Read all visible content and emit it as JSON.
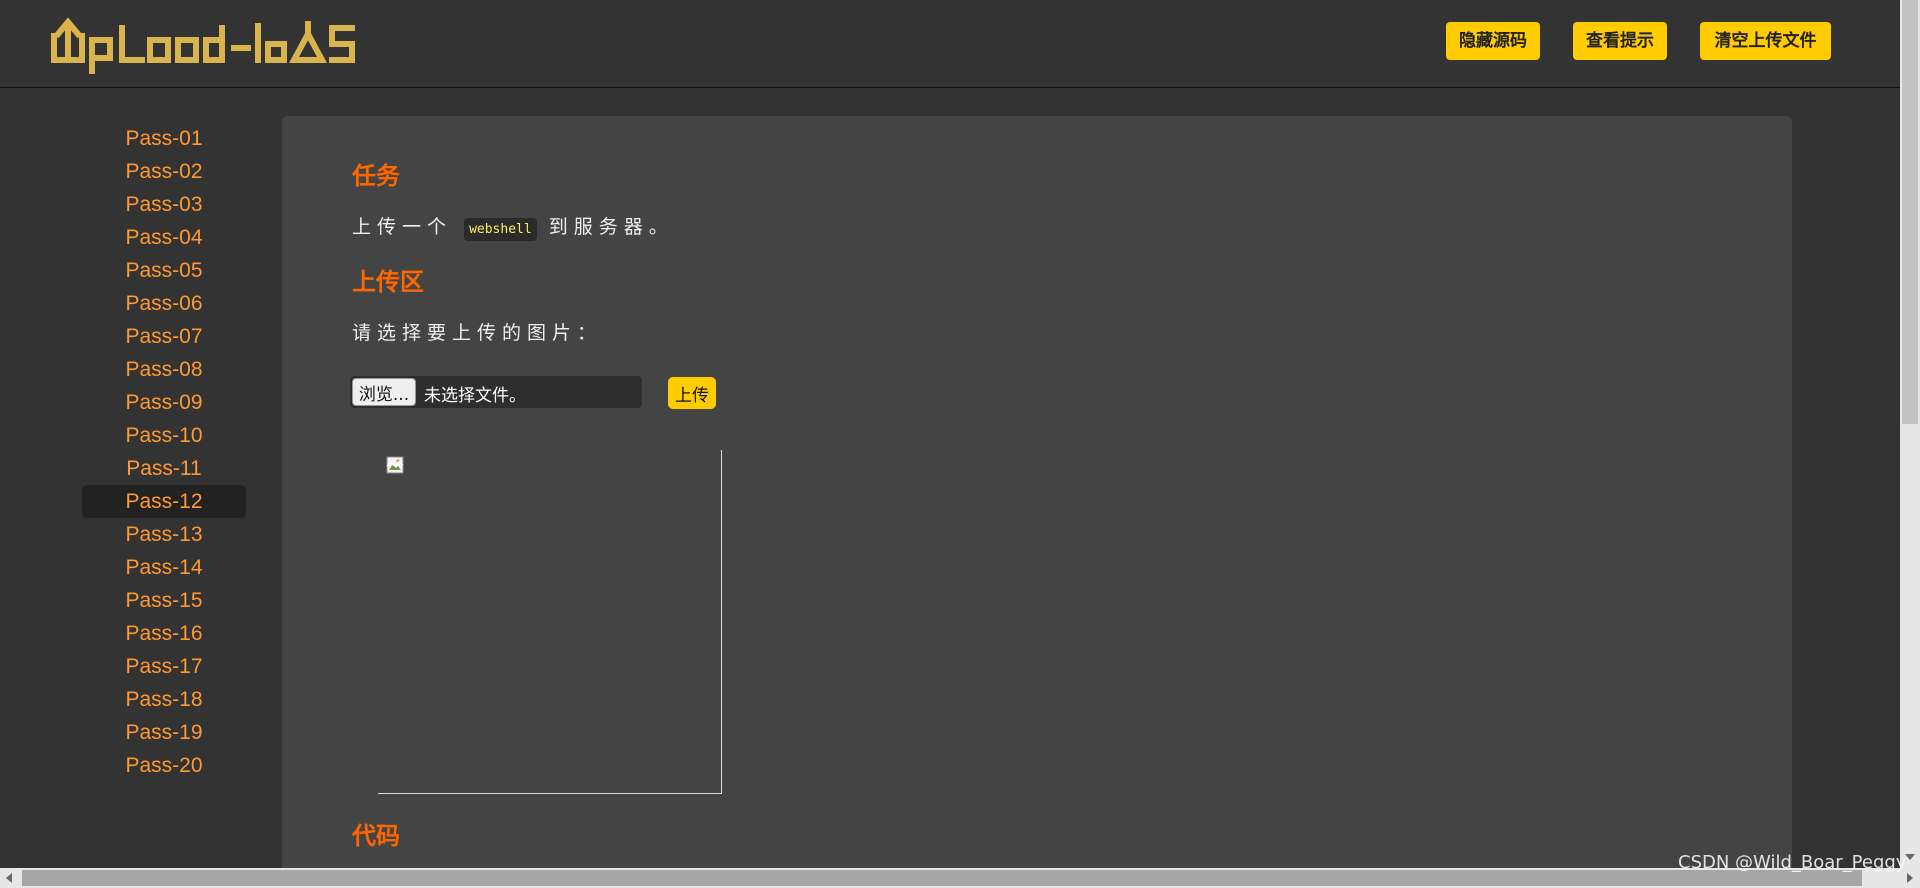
{
  "header": {
    "logo_text": "UpLoad-labs",
    "buttons": [
      "隐藏源码",
      "查看提示",
      "清空上传文件"
    ]
  },
  "sidebar": {
    "items": [
      "Pass-01",
      "Pass-02",
      "Pass-03",
      "Pass-04",
      "Pass-05",
      "Pass-06",
      "Pass-07",
      "Pass-08",
      "Pass-09",
      "Pass-10",
      "Pass-11",
      "Pass-12",
      "Pass-13",
      "Pass-14",
      "Pass-15",
      "Pass-16",
      "Pass-17",
      "Pass-18",
      "Pass-19",
      "Pass-20"
    ],
    "active": "Pass-12"
  },
  "main": {
    "task_title": "任务",
    "task_before": "上传一个",
    "task_code": "webshell",
    "task_after": "到服务器。",
    "upload_title": "上传区",
    "upload_prompt": "请选择要上传的图片：",
    "browse_label": "浏览...",
    "file_status": "未选择文件。",
    "upload_button": "上传",
    "code_title": "代码"
  },
  "watermark": "CSDN @Wild_Boar_Peggy",
  "colors": {
    "accent": "#ffcc00",
    "nav_link": "#ff9933",
    "heading": "#ff6600",
    "panel": "#444444",
    "background": "#333333"
  }
}
